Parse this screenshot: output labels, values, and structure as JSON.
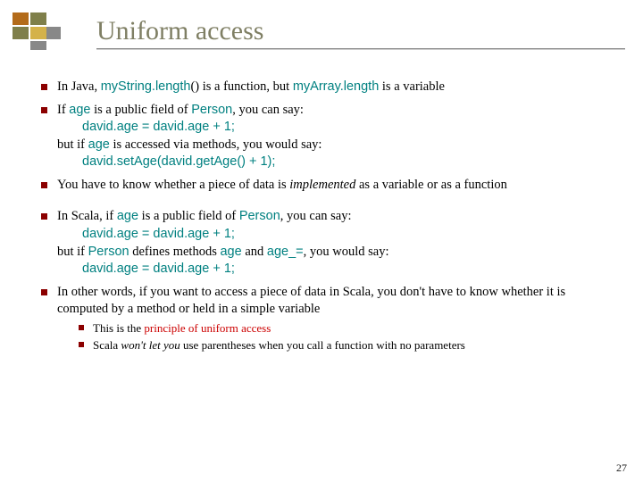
{
  "title": "Uniform access",
  "page_number": "27",
  "bullets": {
    "b1": {
      "pre": "In Java, ",
      "c1": "myString.length",
      "paren": "() is a function, but ",
      "c2": "myArray.length",
      "post": " is a variable"
    },
    "b2": {
      "l1a": "If ",
      "l1c": "age",
      "l1b": " is a public field of ",
      "l1c2": "Person",
      "l1d": ", you can say:",
      "code1": "david.age = david.age + 1;",
      "l2a": "but if ",
      "l2c": "age",
      "l2b": " is accessed via methods, you would say:",
      "code2": "david.setAge(david.getAge() + 1);"
    },
    "b3": {
      "a": "You have to know whether a piece of data is ",
      "b": "implemented",
      "c": " as a variable or as a function"
    },
    "b4": {
      "l1a": "In Scala, if ",
      "l1c": "age",
      "l1b": " is a public field of ",
      "l1c2": "Person",
      "l1d": ", you can say:",
      "code1": "david.age = david.age + 1;",
      "l2a": "but if ",
      "l2c1": "Person",
      "l2b": " defines methods ",
      "l2c2": "age",
      "l2c": " and ",
      "l2c3": "age_=",
      "l2d": ", you would say:",
      "code2": "david.age = david.age + 1;"
    },
    "b5": {
      "text": "In other words, if you want to access a piece of data in Scala, you don't have to know whether it is computed by a method or held in a simple variable"
    },
    "sub1": {
      "a": "This is the ",
      "b": "principle of uniform access"
    },
    "sub2": {
      "a": "Scala ",
      "b": "won't let you",
      "c": " use parentheses when you call a function with no parameters"
    }
  }
}
